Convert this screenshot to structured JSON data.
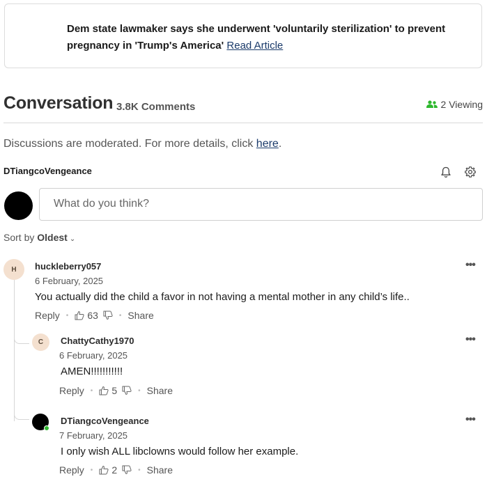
{
  "article": {
    "headline": "Dem state lawmaker says she underwent 'voluntarily sterilization' to prevent pregnancy in 'Trump's America'",
    "link_label": "Read Article"
  },
  "conversation": {
    "title": "Conversation",
    "count": "3.8K Comments",
    "viewing": "2 Viewing",
    "viewing_icon": "users-icon",
    "accent": "#2eb82e"
  },
  "moderation": {
    "text": "Discussions are moderated. For more details, click ",
    "link": "here",
    "end": "."
  },
  "current_user": {
    "name": "DTiangcoVengeance",
    "placeholder": "What do you think?"
  },
  "sort": {
    "prefix": "Sort by",
    "value": "Oldest"
  },
  "comments": [
    {
      "initial": "H",
      "user": "huckleberry057",
      "date": "6 February, 2025",
      "body": "You actually did the child a favor in not having a mental mother in any child’s life..",
      "reply": "Reply",
      "likes": "63",
      "share": "Share"
    },
    {
      "initial": "C",
      "user": "ChattyCathy1970",
      "date": "6 February, 2025",
      "body": "AMEN!!!!!!!!!!!",
      "reply": "Reply",
      "likes": "5",
      "share": "Share"
    },
    {
      "initial": "",
      "user": "DTiangcoVengeance",
      "date": "7 February, 2025",
      "body": "I only wish ALL libclowns would follow her example.",
      "reply": "Reply",
      "likes": "2",
      "share": "Share"
    }
  ]
}
